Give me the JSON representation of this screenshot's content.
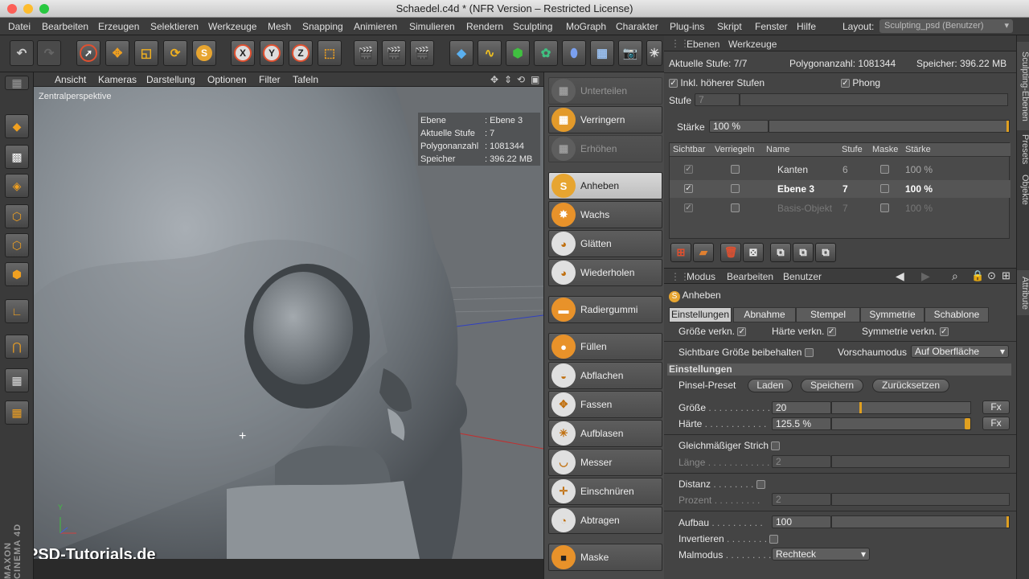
{
  "window": {
    "title": "Schaedel.c4d * (NFR Version – Restricted License)"
  },
  "menu": [
    "Datei",
    "Bearbeiten",
    "Erzeugen",
    "Selektieren",
    "Werkzeuge",
    "Mesh",
    "Snapping",
    "Animieren",
    "Simulieren",
    "Rendern",
    "Sculpting",
    "MoGraph",
    "Charakter",
    "Plug-ins",
    "Skript",
    "Fenster",
    "Hilfe"
  ],
  "layout": {
    "label": "Layout:",
    "value": "Sculpting_psd (Benutzer)"
  },
  "viewport": {
    "menu": [
      "Ansicht",
      "Kameras",
      "Darstellung",
      "Optionen",
      "Filter",
      "Tafeln"
    ],
    "view_name": "Zentralperspektive",
    "hud": [
      {
        "key": "Ebene",
        "value": ": Ebene 3"
      },
      {
        "key": "Aktuelle Stufe",
        "value": ": 7"
      },
      {
        "key": "Polygonanzahl",
        "value": ": 1081344"
      },
      {
        "key": "Speicher",
        "value": ": 396.22 MB"
      }
    ],
    "watermark": "PSD-Tutorials.de",
    "brand": "MAXON CINEMA 4D",
    "axis_y": "Y"
  },
  "brushes": [
    {
      "label": "Unterteilen",
      "enabled": false
    },
    {
      "label": "Verringern",
      "enabled": true
    },
    {
      "label": "Erhöhen",
      "enabled": false
    },
    {
      "label": "Anheben",
      "enabled": true,
      "active": true
    },
    {
      "label": "Wachs",
      "enabled": true
    },
    {
      "label": "Glätten",
      "enabled": true
    },
    {
      "label": "Wiederholen",
      "enabled": true
    },
    {
      "label": "Radiergummi",
      "enabled": true
    },
    {
      "label": "Füllen",
      "enabled": true
    },
    {
      "label": "Abflachen",
      "enabled": true
    },
    {
      "label": "Fassen",
      "enabled": true
    },
    {
      "label": "Aufblasen",
      "enabled": true
    },
    {
      "label": "Messer",
      "enabled": true
    },
    {
      "label": "Einschnüren",
      "enabled": true
    },
    {
      "label": "Abtragen",
      "enabled": true
    },
    {
      "label": "Maske",
      "enabled": true
    }
  ],
  "layers_panel": {
    "menu": [
      "Ebenen",
      "Werkzeuge"
    ],
    "current_level": "Aktuelle Stufe: 7/7",
    "polycount": "Polygonanzahl: 1081344",
    "memory": "Speicher: 396.22 MB",
    "incl_higher": "Inkl. höherer Stufen",
    "phong": "Phong",
    "level_label": "Stufe",
    "level_value": "7",
    "strength_label": "Stärke",
    "strength_value": "100 %",
    "columns": [
      "Sichtbar",
      "Verriegeln",
      "Name",
      "Stufe",
      "Maske",
      "Stärke"
    ],
    "rows": [
      {
        "name": "Kanten",
        "level": "6",
        "strength": "100 %",
        "visible": true
      },
      {
        "name": "Ebene 3",
        "level": "7",
        "strength": "100 %",
        "visible": true
      },
      {
        "name": "Basis-Objekt",
        "level": "7",
        "strength": "100 %",
        "visible": true
      }
    ]
  },
  "attributes": {
    "menu": [
      "Modus",
      "Bearbeiten",
      "Benutzer"
    ],
    "tool_name": "Anheben",
    "tabs": [
      "Einstellungen",
      "Abnahme",
      "Stempel",
      "Symmetrie",
      "Schablone"
    ],
    "size_linked": "Größe verkn.",
    "hardness_linked": "Härte verkn.",
    "symmetry_linked": "Symmetrie verkn.",
    "keep_visible_size": "Sichtbare Größe beibehalten",
    "preview_mode_label": "Vorschaumodus",
    "preview_mode_value": "Auf Oberfläche",
    "section": "Einstellungen",
    "preset_label": "Pinsel-Preset",
    "btn_load": "Laden",
    "btn_save": "Speichern",
    "btn_reset": "Zurücksetzen",
    "size_label": "Größe",
    "size_value": "20",
    "size_fraction": 0.2,
    "hardness_label": "Härte",
    "hardness_value": "125.5 %",
    "hardness_fraction": 1.0,
    "fx": "Fx",
    "even_stroke": "Gleichmäßiger Strich",
    "length_label": "Länge",
    "length_value": "2",
    "distance_label": "Distanz",
    "percent_label": "Prozent",
    "percent_value": "2",
    "buildup_label": "Aufbau",
    "buildup_value": "100",
    "invert_label": "Invertieren",
    "paint_mode_label": "Malmodus",
    "paint_mode_value": "Rechteck"
  },
  "side_tabs": [
    "Sculpting-Ebenen",
    "Presets",
    "Objekte",
    "Attribute"
  ],
  "colors": {
    "accent": "#e0a020",
    "bg_panel": "#444444",
    "viewport": "#6b6f73"
  }
}
